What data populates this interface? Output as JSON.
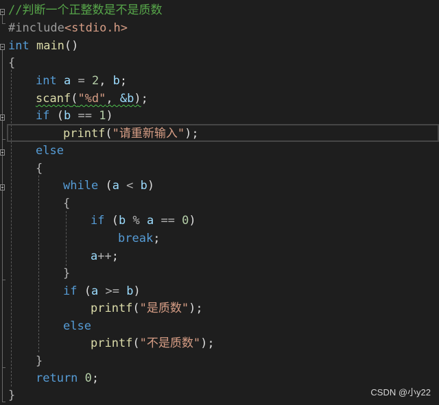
{
  "code": {
    "comment": "//判断一个正整数是不是质数",
    "pp_include": "#include",
    "header": "<stdio.h>",
    "kw_int": "int",
    "fn_main": "main",
    "parens": "()",
    "open_brace": "{",
    "close_brace": "}",
    "var_a": "a",
    "var_b": "b",
    "op_assign": " = ",
    "num_2": "2",
    "comma": ", ",
    "semicolon": ";",
    "fn_scanf": "scanf",
    "lparen": "(",
    "rparen": ")",
    "str_fmt": "\"%d\"",
    "amp_b": "&b",
    "kw_if": "if",
    "op_eq": " == ",
    "num_1": "1",
    "fn_printf": "printf",
    "str_reenter": "\"请重新输入\"",
    "kw_else": "else",
    "kw_while": "while",
    "op_lt": " < ",
    "op_mod": " % ",
    "num_0": "0",
    "kw_break": "break",
    "op_inc": "++",
    "op_ge": " >= ",
    "str_prime": "\"是质数\"",
    "str_notprime": "\"不是质数\"",
    "kw_return": "return",
    "sp": " "
  },
  "watermark": "CSDN @小y22"
}
